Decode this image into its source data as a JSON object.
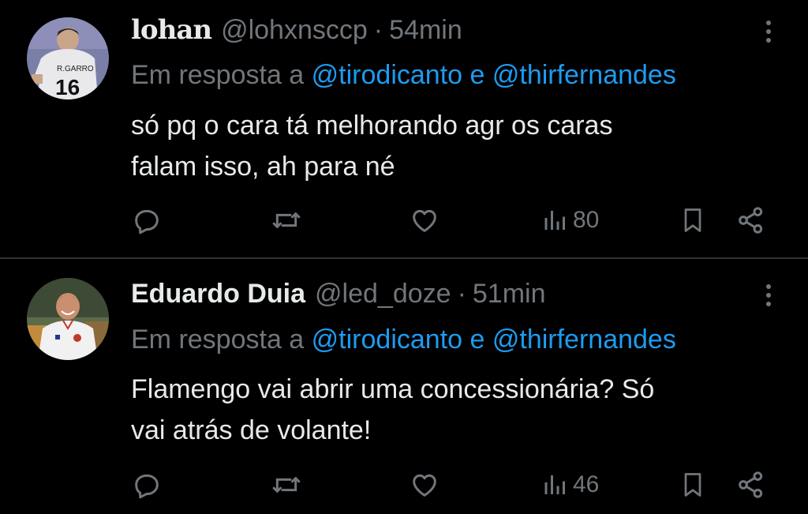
{
  "colors": {
    "background": "#000000",
    "text_primary": "#e7e9ea",
    "text_secondary": "#71767b",
    "accent_link": "#1d9bf0",
    "divider": "#2f3336"
  },
  "tweets": [
    {
      "display_name": "lohan",
      "handle": "@lohxnsccp",
      "separator": "·",
      "time": "54min",
      "reply_prefix": "Em resposta a",
      "reply_mentions": "@tirodicanto e @thirfernandes",
      "text_lines": [
        "só pq o cara tá melhorando agr os caras",
        "falam isso, ah para né"
      ],
      "views": "80",
      "avatar": "avatar-jersey-16"
    },
    {
      "display_name": "Eduardo Duia",
      "handle": "@led_doze",
      "separator": "·",
      "time": "51min",
      "reply_prefix": "Em resposta a",
      "reply_mentions": "@tirodicanto e @thirfernandes",
      "text_lines": [
        "Flamengo vai abrir uma concessionária? Só",
        "vai atrás de volante!"
      ],
      "views": "46",
      "avatar": "avatar-smiling-man"
    }
  ],
  "icons": {
    "reply": "reply-icon",
    "retweet": "retweet-icon",
    "like": "heart-icon",
    "views": "views-icon",
    "bookmark": "bookmark-icon",
    "share": "share-icon",
    "more": "more-options-icon"
  }
}
